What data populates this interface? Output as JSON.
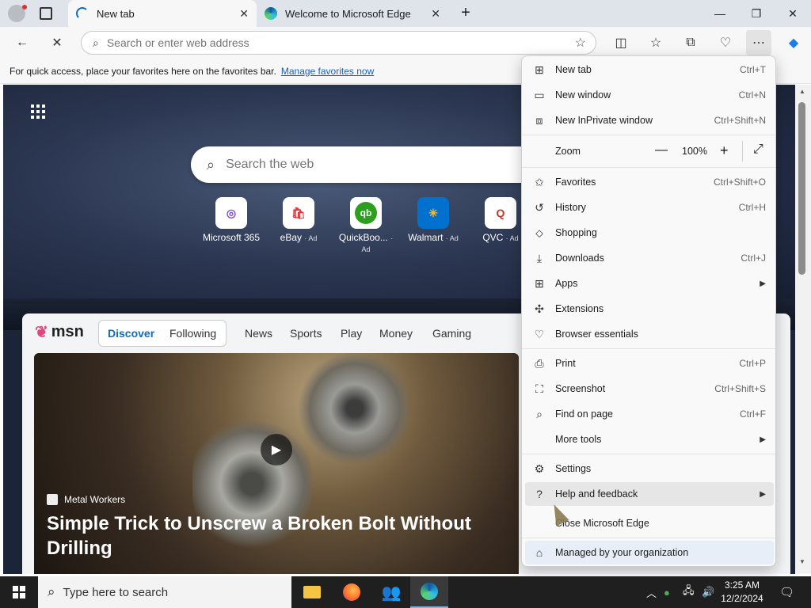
{
  "tabs": [
    {
      "label": "New tab",
      "active": true
    },
    {
      "label": "Welcome to Microsoft Edge",
      "active": false
    }
  ],
  "address_bar": {
    "placeholder": "Search or enter web address"
  },
  "favorites_bar": {
    "text": "For quick access, place your favorites here on the favorites bar.",
    "link": "Manage favorites now"
  },
  "newtab": {
    "search_placeholder": "Search the web",
    "quick_links": [
      {
        "label": "Microsoft 365",
        "ad": ""
      },
      {
        "label": "eBay",
        "ad": "· Ad"
      },
      {
        "label": "QuickBoo...",
        "ad": "· Ad"
      },
      {
        "label": "Walmart",
        "ad": "· Ad"
      },
      {
        "label": "QVC",
        "ad": "· Ad"
      }
    ],
    "msn_logo": "msn",
    "nav": [
      "Discover",
      "Following",
      "News",
      "Sports",
      "Play",
      "Money",
      "Gaming"
    ],
    "hero": {
      "source": "Metal Workers",
      "headline": "Simple Trick to Unscrew a Broken Bolt Without Drilling"
    }
  },
  "menu": {
    "items": [
      {
        "label": "New tab",
        "shortcut": "Ctrl+T",
        "icon": "new-tab-icon"
      },
      {
        "label": "New window",
        "shortcut": "Ctrl+N",
        "icon": "new-window-icon"
      },
      {
        "label": "New InPrivate window",
        "shortcut": "Ctrl+Shift+N",
        "icon": "inprivate-icon"
      },
      {
        "label": "Zoom",
        "icon": ""
      },
      {
        "label": "Favorites",
        "shortcut": "Ctrl+Shift+O",
        "icon": "star-icon"
      },
      {
        "label": "History",
        "shortcut": "Ctrl+H",
        "icon": "history-icon"
      },
      {
        "label": "Shopping",
        "icon": "tag-icon"
      },
      {
        "label": "Downloads",
        "shortcut": "Ctrl+J",
        "icon": "download-icon"
      },
      {
        "label": "Apps",
        "icon": "apps-icon"
      },
      {
        "label": "Extensions",
        "icon": "puzzle-icon"
      },
      {
        "label": "Browser essentials",
        "icon": "heart-icon"
      },
      {
        "label": "Print",
        "shortcut": "Ctrl+P",
        "icon": "print-icon"
      },
      {
        "label": "Screenshot",
        "shortcut": "Ctrl+Shift+S",
        "icon": "screenshot-icon"
      },
      {
        "label": "Find on page",
        "shortcut": "Ctrl+F",
        "icon": "find-icon"
      },
      {
        "label": "More tools",
        "icon": ""
      },
      {
        "label": "Settings",
        "icon": "gear-icon"
      },
      {
        "label": "Help and feedback",
        "icon": "help-icon"
      },
      {
        "label": "Close Microsoft Edge",
        "icon": ""
      },
      {
        "label": "Managed by your organization",
        "icon": "briefcase-icon"
      }
    ],
    "zoom_value": "100%"
  },
  "taskbar": {
    "search_placeholder": "Type here to search",
    "time": "3:25 AM",
    "date": "12/2/2024"
  },
  "colors": {
    "accent": "#0f6cbd",
    "taskbar": "#1f1f1f",
    "titlebar": "#dfe3ea"
  }
}
